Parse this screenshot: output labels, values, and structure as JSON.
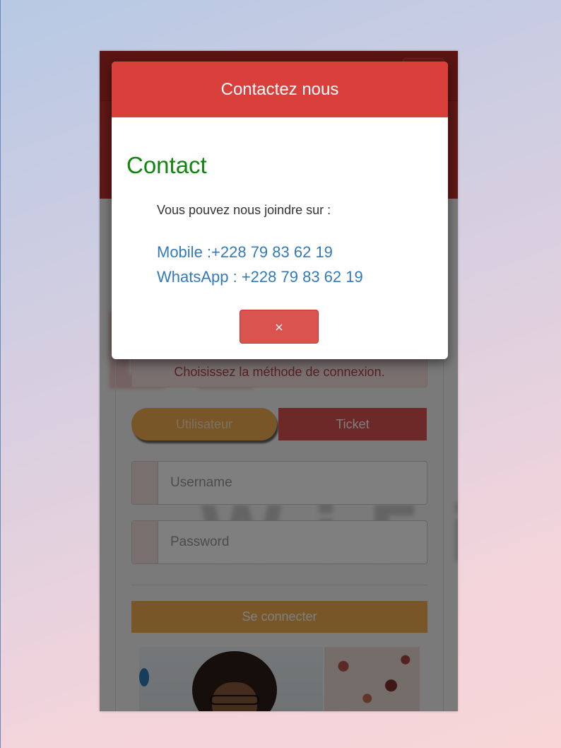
{
  "login": {
    "alert_text": "Choisissez la méthode de connexion.",
    "tabs": [
      {
        "label": "Utilisateur",
        "active": true
      },
      {
        "label": "Ticket",
        "active": false
      }
    ],
    "username_placeholder": "Username",
    "password_placeholder": "Password",
    "submit_label": "Se connecter"
  },
  "modal": {
    "header_title": "Contactez nous",
    "heading": "Contact",
    "intro": "Vous pouvez nous joindre sur :",
    "mobile": "Mobile :+228 79 83 62 19",
    "whatsapp": "WhatsApp : +228 79 83 62 19",
    "close_label": "×"
  },
  "colors": {
    "header_red": "#d9403b",
    "contact_green": "#11860f",
    "link_blue": "#337ab7",
    "accent_orange": "#f0ad4e",
    "danger_red": "#d9534f"
  }
}
